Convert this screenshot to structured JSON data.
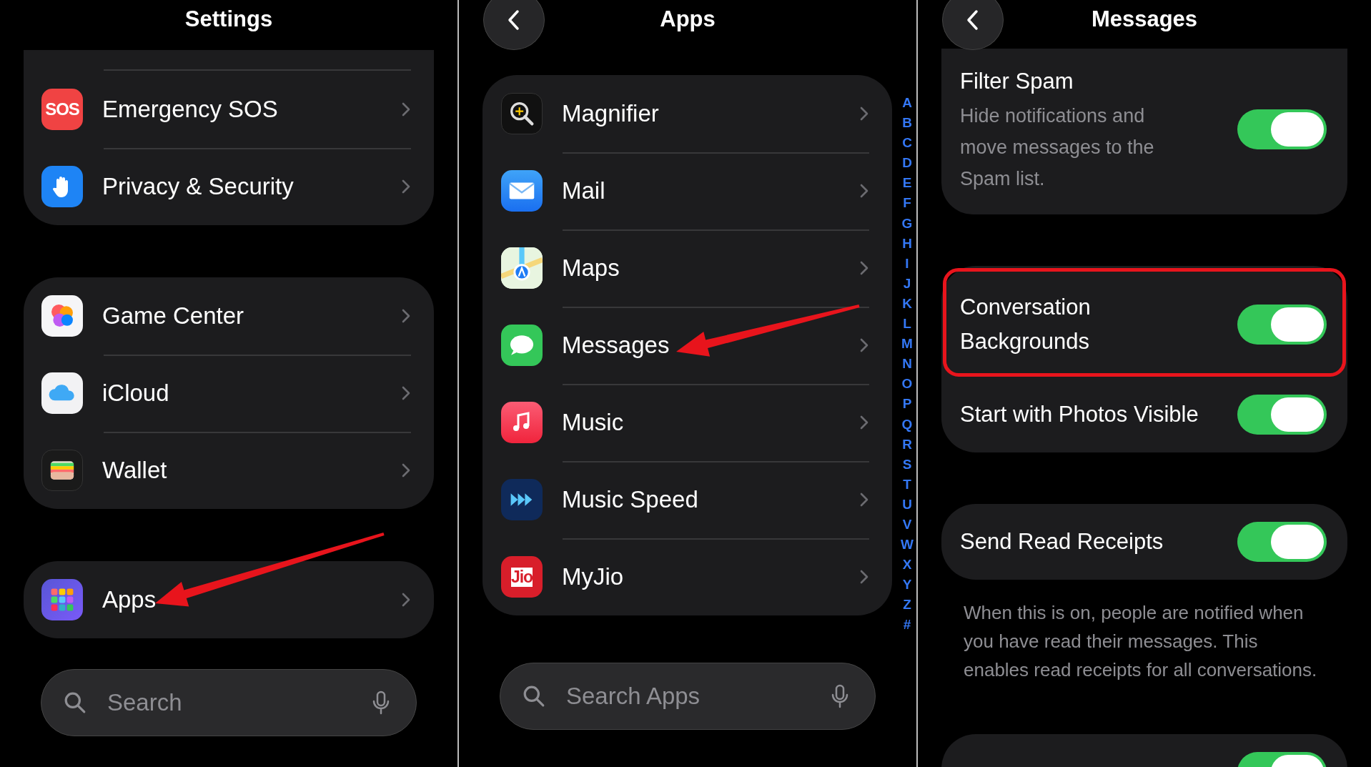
{
  "settings": {
    "title": "Settings",
    "groups": [
      {
        "items": [
          {
            "label": "Emergency SOS",
            "icon_text": "SOS",
            "arrow": false
          },
          {
            "label": "Privacy & Security",
            "arrow": false
          }
        ]
      },
      {
        "items": [
          {
            "label": "Game Center",
            "arrow": false
          },
          {
            "label": "iCloud",
            "arrow": false
          },
          {
            "label": "Wallet",
            "arrow": false
          }
        ]
      },
      {
        "items": [
          {
            "label": "Apps",
            "arrow": true
          }
        ]
      }
    ],
    "search": {
      "placeholder": "Search"
    }
  },
  "apps": {
    "title": "Apps",
    "items": [
      {
        "label": "Magnifier",
        "arrow": false
      },
      {
        "label": "Mail",
        "arrow": false
      },
      {
        "label": "Maps",
        "arrow": false
      },
      {
        "label": "Messages",
        "arrow": true
      },
      {
        "label": "Music",
        "arrow": false
      },
      {
        "label": "Music Speed",
        "arrow": false
      },
      {
        "label": "MyJio",
        "icon_text": "Jio",
        "arrow": false
      }
    ],
    "index_letters": [
      "A",
      "B",
      "C",
      "D",
      "E",
      "F",
      "G",
      "H",
      "I",
      "J",
      "K",
      "L",
      "M",
      "N",
      "O",
      "P",
      "Q",
      "R",
      "S",
      "T",
      "U",
      "V",
      "W",
      "X",
      "Y",
      "Z",
      "#"
    ],
    "search": {
      "placeholder": "Search Apps"
    }
  },
  "messages": {
    "title": "Messages",
    "groups": [
      {
        "rows": [
          {
            "label": "Filter Spam",
            "description": "Hide notifications and move messages to the Spam list.",
            "on": true,
            "highlighted": false
          }
        ]
      },
      {
        "rows": [
          {
            "label": "Conversation Backgrounds",
            "on": true,
            "highlighted": true
          },
          {
            "label": "Start with Photos Visible",
            "on": true,
            "highlighted": false
          }
        ]
      },
      {
        "rows": [
          {
            "label": "Send Read Receipts",
            "on": true,
            "highlighted": false
          }
        ],
        "footer": "When this is on, people are notified when you have read their messages. This enables read receipts for all conversations."
      },
      {
        "rows": [
          {
            "on": true,
            "highlighted": false
          }
        ]
      }
    ]
  }
}
